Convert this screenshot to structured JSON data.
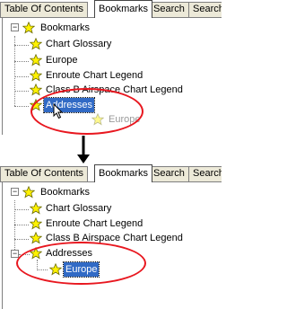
{
  "tabs": [
    "Table Of Contents",
    "Bookmarks",
    "Search",
    "Search"
  ],
  "top_tree": {
    "root": "Bookmarks",
    "items": [
      "Chart Glossary",
      "Europe",
      "Enroute Chart Legend",
      "Class B Airspace Chart Legend",
      "Addresses"
    ],
    "dragged_item": "Europe"
  },
  "bottom_tree": {
    "root": "Bookmarks",
    "items": [
      "Chart Glossary",
      "Enroute Chart Legend",
      "Class B Airspace Chart Legend"
    ],
    "folder": "Addresses",
    "child": "Europe"
  },
  "colors": {
    "highlight": "#e8171f",
    "selection": "#316ac5",
    "star_fill": "#fff200",
    "tab_bg": "#ece9d8"
  },
  "icons": {
    "bookmark": "star-icon",
    "expander": "minus-box-icon",
    "cursor": "drag-arrow-cursor-icon",
    "arrow": "down-arrow-icon"
  }
}
